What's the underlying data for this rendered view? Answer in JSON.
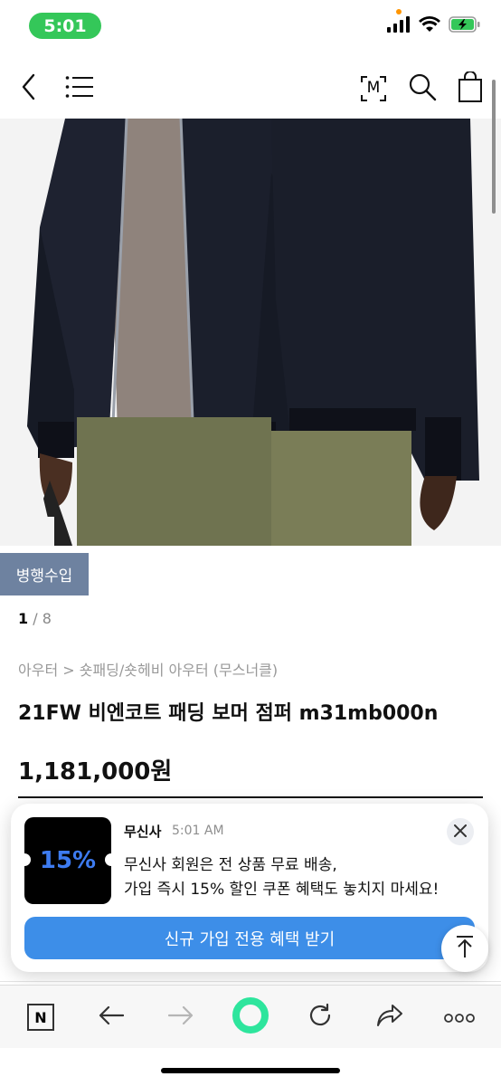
{
  "status_bar": {
    "time": "5:01"
  },
  "nav": {
    "back_icon": "chevron-left-icon",
    "menu_icon": "hamburger-menu-icon",
    "brand_icon": "m-logo-icon",
    "brand_letter": "M",
    "search_icon": "search-icon",
    "cart_icon": "shopping-bag-icon"
  },
  "product": {
    "badge": "병행수입",
    "pager_current": "1",
    "pager_total": " / 8",
    "breadcrumb": "아우터 > 숏패딩/숏헤비 아우터 (무스너클)",
    "title": "21FW 비엔코트 패딩 보머 점퍼 m31mb000n",
    "price": "1,181,000원"
  },
  "notification": {
    "sender": "무신사",
    "time": "5:01 AM",
    "coupon": "15%",
    "body_line1": "무신사 회원은 전 상품 무료 배송,",
    "body_line2": "가입 즉시 15% 할인 쿠폰 혜택도 놓치지 마세요!",
    "cta": "신규 가입 전용 혜택 받기"
  },
  "toolbar": {
    "items": [
      "n-home-icon",
      "arrow-back-icon",
      "arrow-forward-icon",
      "green-ring-icon",
      "reload-icon",
      "share-icon",
      "more-icon"
    ],
    "n_letter": "N"
  },
  "colors": {
    "status_green": "#34c759",
    "badge": "#6e82a0",
    "cta_blue": "#3d8ee8",
    "coupon_blue": "#3d7bf0",
    "ring_green": "#2ee59d"
  }
}
